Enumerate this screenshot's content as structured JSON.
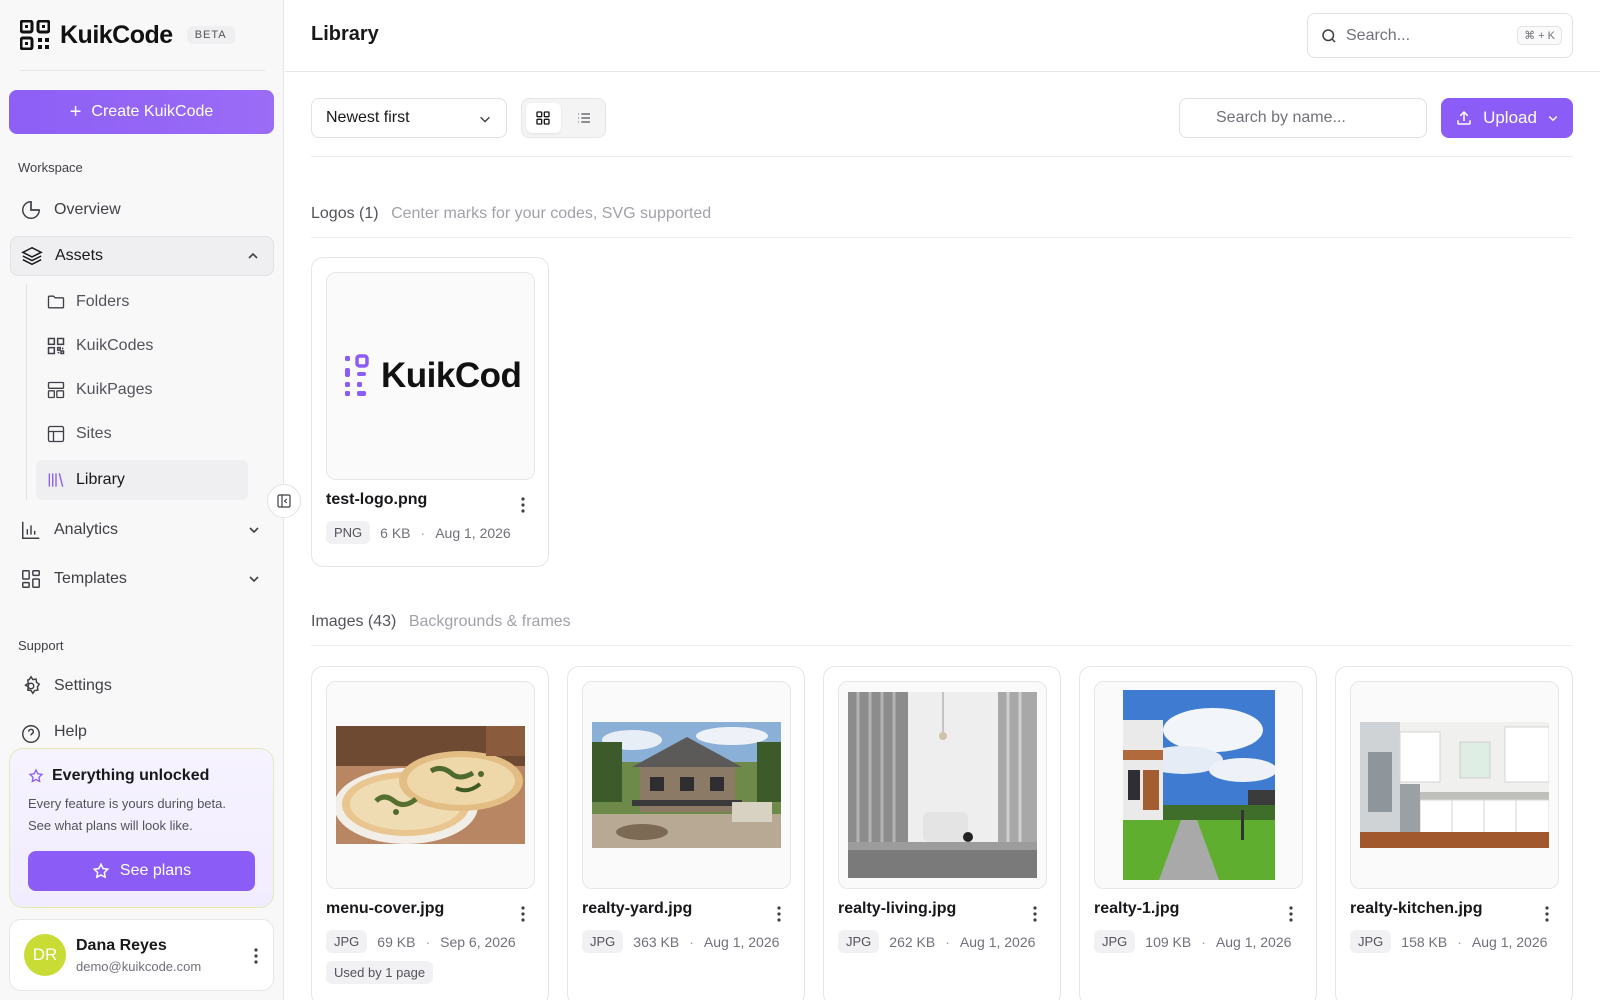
{
  "brand": {
    "name": "KuikCode",
    "badge": "BETA"
  },
  "sidebar": {
    "create_label": "Create KuikCode",
    "workspace_label": "Workspace",
    "support_label": "Support",
    "nav": {
      "overview": "Overview",
      "assets": "Assets",
      "folders": "Folders",
      "kuikcodes": "KuikCodes",
      "kuikpages": "KuikPages",
      "sites": "Sites",
      "library": "Library",
      "analytics": "Analytics",
      "templates": "Templates",
      "settings": "Settings",
      "help": "Help"
    },
    "upgrade": {
      "title": "Everything unlocked",
      "desc_line1": "Every feature is yours during beta.",
      "desc_line2": "See what plans will look like.",
      "button": "See plans"
    },
    "user": {
      "initials": "DR",
      "name": "Dana Reyes",
      "email": "demo@kuikcode.com"
    }
  },
  "header": {
    "title": "Library",
    "search_placeholder": "Search...",
    "search_shortcut": "⌘ + K"
  },
  "toolbar": {
    "sort_value": "Newest first",
    "name_search_placeholder": "Search by name...",
    "upload_label": "Upload"
  },
  "groups": {
    "logos": {
      "name": "Logos",
      "count": "(1)",
      "desc": "Center marks for your codes, SVG supported"
    },
    "images": {
      "name": "Images",
      "count": "(43)",
      "desc": "Backgrounds & frames"
    }
  },
  "logo_preview_text": "KuikCod",
  "assets": {
    "logo1": {
      "name": "test-logo.png",
      "type": "PNG",
      "size": "6 KB",
      "date": "Aug 1, 2026"
    },
    "img1": {
      "name": "menu-cover.jpg",
      "type": "JPG",
      "size": "69 KB",
      "date": "Sep 6, 2026",
      "used": "Used by 1 page"
    },
    "img2": {
      "name": "realty-yard.jpg",
      "type": "JPG",
      "size": "363 KB",
      "date": "Aug 1, 2026"
    },
    "img3": {
      "name": "realty-living.jpg",
      "type": "JPG",
      "size": "262 KB",
      "date": "Aug 1, 2026"
    },
    "img4": {
      "name": "realty-1.jpg",
      "type": "JPG",
      "size": "109 KB",
      "date": "Aug 1, 2026"
    },
    "img5": {
      "name": "realty-kitchen.jpg",
      "type": "JPG",
      "size": "158 KB",
      "date": "Aug 1, 2026"
    }
  },
  "colors": {
    "accent": "#8b5cf6",
    "avatar": "#c9dc35"
  }
}
